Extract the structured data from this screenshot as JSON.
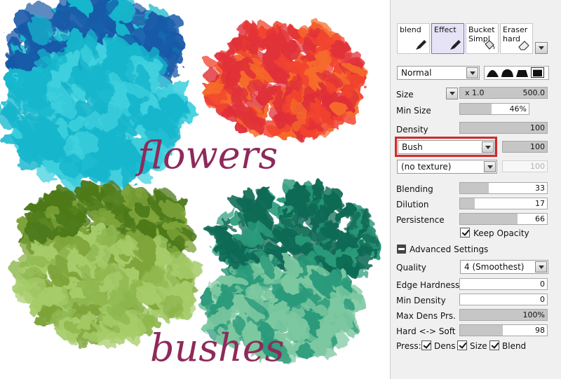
{
  "art": {
    "flowers_label": "flowers",
    "bushes_label": "bushes",
    "colors": {
      "blue_deep": "#1a5aa8",
      "cyan": "#16b6cc",
      "cyan_light": "#3fd0de",
      "red": "#e03038",
      "orange": "#f56a2a",
      "olive_dark": "#4e7a1a",
      "olive": "#7ea43a",
      "lime": "#a6cc6a",
      "teal_dark": "#0f6a55",
      "teal": "#2a9a7a",
      "mint": "#7cc8a0",
      "label": "#8e2a5a"
    }
  },
  "panel": {
    "brushes": [
      {
        "name": "blend",
        "icon": "pen-icon"
      },
      {
        "name": "Effect",
        "icon": "pen-icon",
        "selected": true
      },
      {
        "name": "Bucket Simpl",
        "icon": "bucket-icon"
      },
      {
        "name": "Eraser hard",
        "icon": "eraser-icon"
      }
    ],
    "blend_mode": "Normal",
    "size": {
      "label": "Size",
      "multiplier": "x 1.0",
      "value": "500.0"
    },
    "min_size": {
      "label": "Min Size",
      "value": "46%",
      "fraction": 0.46
    },
    "density": {
      "label": "Density",
      "value": "100",
      "fraction": 1.0
    },
    "brush_shape": {
      "value": "Bush",
      "amount": "100",
      "fraction": 1.0
    },
    "brush_texture": {
      "value": "(no texture)",
      "amount": "100"
    },
    "blending": {
      "label": "Blending",
      "value": "33",
      "fraction": 0.33
    },
    "dilution": {
      "label": "Dilution",
      "value": "17",
      "fraction": 0.17
    },
    "persistence": {
      "label": "Persistence",
      "value": "66",
      "fraction": 0.66
    },
    "keep_opacity": "Keep Opacity",
    "advanced_settings": "Advanced Settings",
    "quality": {
      "label": "Quality",
      "value": "4 (Smoothest)"
    },
    "edge_hardness": {
      "label": "Edge Hardness",
      "value": "0",
      "fraction": 0.0
    },
    "min_density": {
      "label": "Min Density",
      "value": "0",
      "fraction": 0.0
    },
    "max_dens_prs": {
      "label": "Max Dens Prs.",
      "value": "100%",
      "fraction": 1.0
    },
    "hard_soft": {
      "label": "Hard <-> Soft",
      "value": "98",
      "fraction": 0.49
    },
    "press": {
      "label": "Press:",
      "dens": "Dens",
      "size": "Size",
      "blend": "Blend"
    }
  }
}
